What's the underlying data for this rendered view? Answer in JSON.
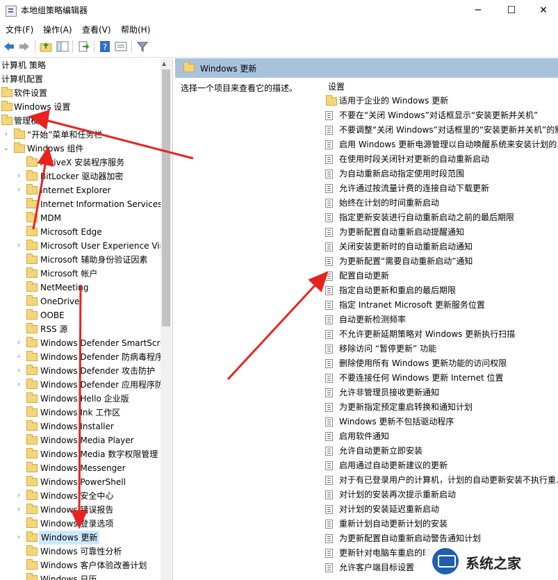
{
  "window": {
    "title": "本地组策略编辑器",
    "min": "─",
    "max": "☐",
    "close": "✕"
  },
  "menu": [
    "文件(F)",
    "操作(A)",
    "查看(V)",
    "帮助(H)"
  ],
  "tree": [
    {
      "label": "计算机 策略"
    },
    {
      "label": "计算机配置"
    },
    {
      "label": "软件设置"
    },
    {
      "label": "Windows 设置"
    },
    {
      "label": "管理模板"
    },
    {
      "label": "“开始”菜单和任务栏"
    },
    {
      "label": "Windows 组件"
    },
    {
      "label": "ActiveX 安装程序服务"
    },
    {
      "label": "BitLocker 驱动器加密"
    },
    {
      "label": "Internet Explorer"
    },
    {
      "label": "Internet Information Services"
    },
    {
      "label": "MDM"
    },
    {
      "label": "Microsoft Edge"
    },
    {
      "label": "Microsoft User Experience Vir"
    },
    {
      "label": "Microsoft 辅助身份验证因素"
    },
    {
      "label": "Microsoft 帐户"
    },
    {
      "label": "NetMeeting"
    },
    {
      "label": "OneDrive"
    },
    {
      "label": "OOBE"
    },
    {
      "label": "RSS 源"
    },
    {
      "label": "Windows Defender SmartScre"
    },
    {
      "label": "Windows Defender 防病毒程序"
    },
    {
      "label": "Windows Defender 攻击防护"
    },
    {
      "label": "Windows Defender 应用程序防"
    },
    {
      "label": "Windows Hello 企业版"
    },
    {
      "label": "Windows Ink 工作区"
    },
    {
      "label": "Windows Installer"
    },
    {
      "label": "Windows Media Player"
    },
    {
      "label": "Windows Media 数字权限管理"
    },
    {
      "label": "Windows Messenger"
    },
    {
      "label": "Windows PowerShell"
    },
    {
      "label": "Windows 安全中心"
    },
    {
      "label": "Windows 错误报告"
    },
    {
      "label": "Windows 登录选项"
    },
    {
      "label": "Windows 更新"
    },
    {
      "label": "Windows 可靠性分析"
    },
    {
      "label": "Windows 客户体验改善计划"
    },
    {
      "label": "Windows 日历"
    }
  ],
  "right": {
    "header": "Windows 更新",
    "description": "选择一个项目来查看它的描述。",
    "settings_header": "设置",
    "folder_item": "适用于企业的 Windows 更新",
    "policies": [
      "不要在“关闭 Windows”对话框显示“安装更新并关机”",
      "不要调整“关闭 Windows”对话框里的“安装更新并关机”的默",
      "启用 Windows 更新电源管理以自动唤醒系统来安装计划的...",
      "在使用时段关闭针对更新的自动重新启动",
      "为自动重新启动指定使用时段范围",
      "允许通过按流量计费的连接自动下载更新",
      "始终在计划的时间重新启动",
      "指定更新安装进行自动重新启动之前的最后期限",
      "为更新配置自动重新启动提醒通知",
      "关闭安装更新时的自动重新启动通知",
      "为更新配置“需要自动重新启动”通知",
      "配置自动更新",
      "指定自动更新和重启的最后期限",
      "指定 Intranet Microsoft 更新服务位置",
      "自动更新检测频率",
      "不允许更新延期策略对 Windows 更新执行扫描",
      "移除访问 “暂停更新” 功能",
      "删除使用所有 Windows 更新功能的访问权限",
      "不要连接任何 Windows 更新 Internet 位置",
      "允许非管理员接收更新通知",
      "为更新指定预定重启转换和通知计划",
      "Windows 更新不包括驱动程序",
      "启用软件通知",
      "允许自动更新立即安装",
      "启用通过自动更新建议的更新",
      "对于有已登录用户的计算机，计划的自动更新安装不执行重...",
      "对计划的安装再次提示重新启动",
      "对计划的安装延迟重新启动",
      "重新计划自动更新计划的安装",
      "为更新配置自动重新启动警告通知计划",
      "更新针对电脑车重启的时间",
      "允许客户端目标设置"
    ]
  },
  "watermark": {
    "text": "系统之家"
  },
  "colors": {
    "selection": "#cce8ff",
    "header": "#a9c2dc",
    "annotation": "#e8231e"
  }
}
